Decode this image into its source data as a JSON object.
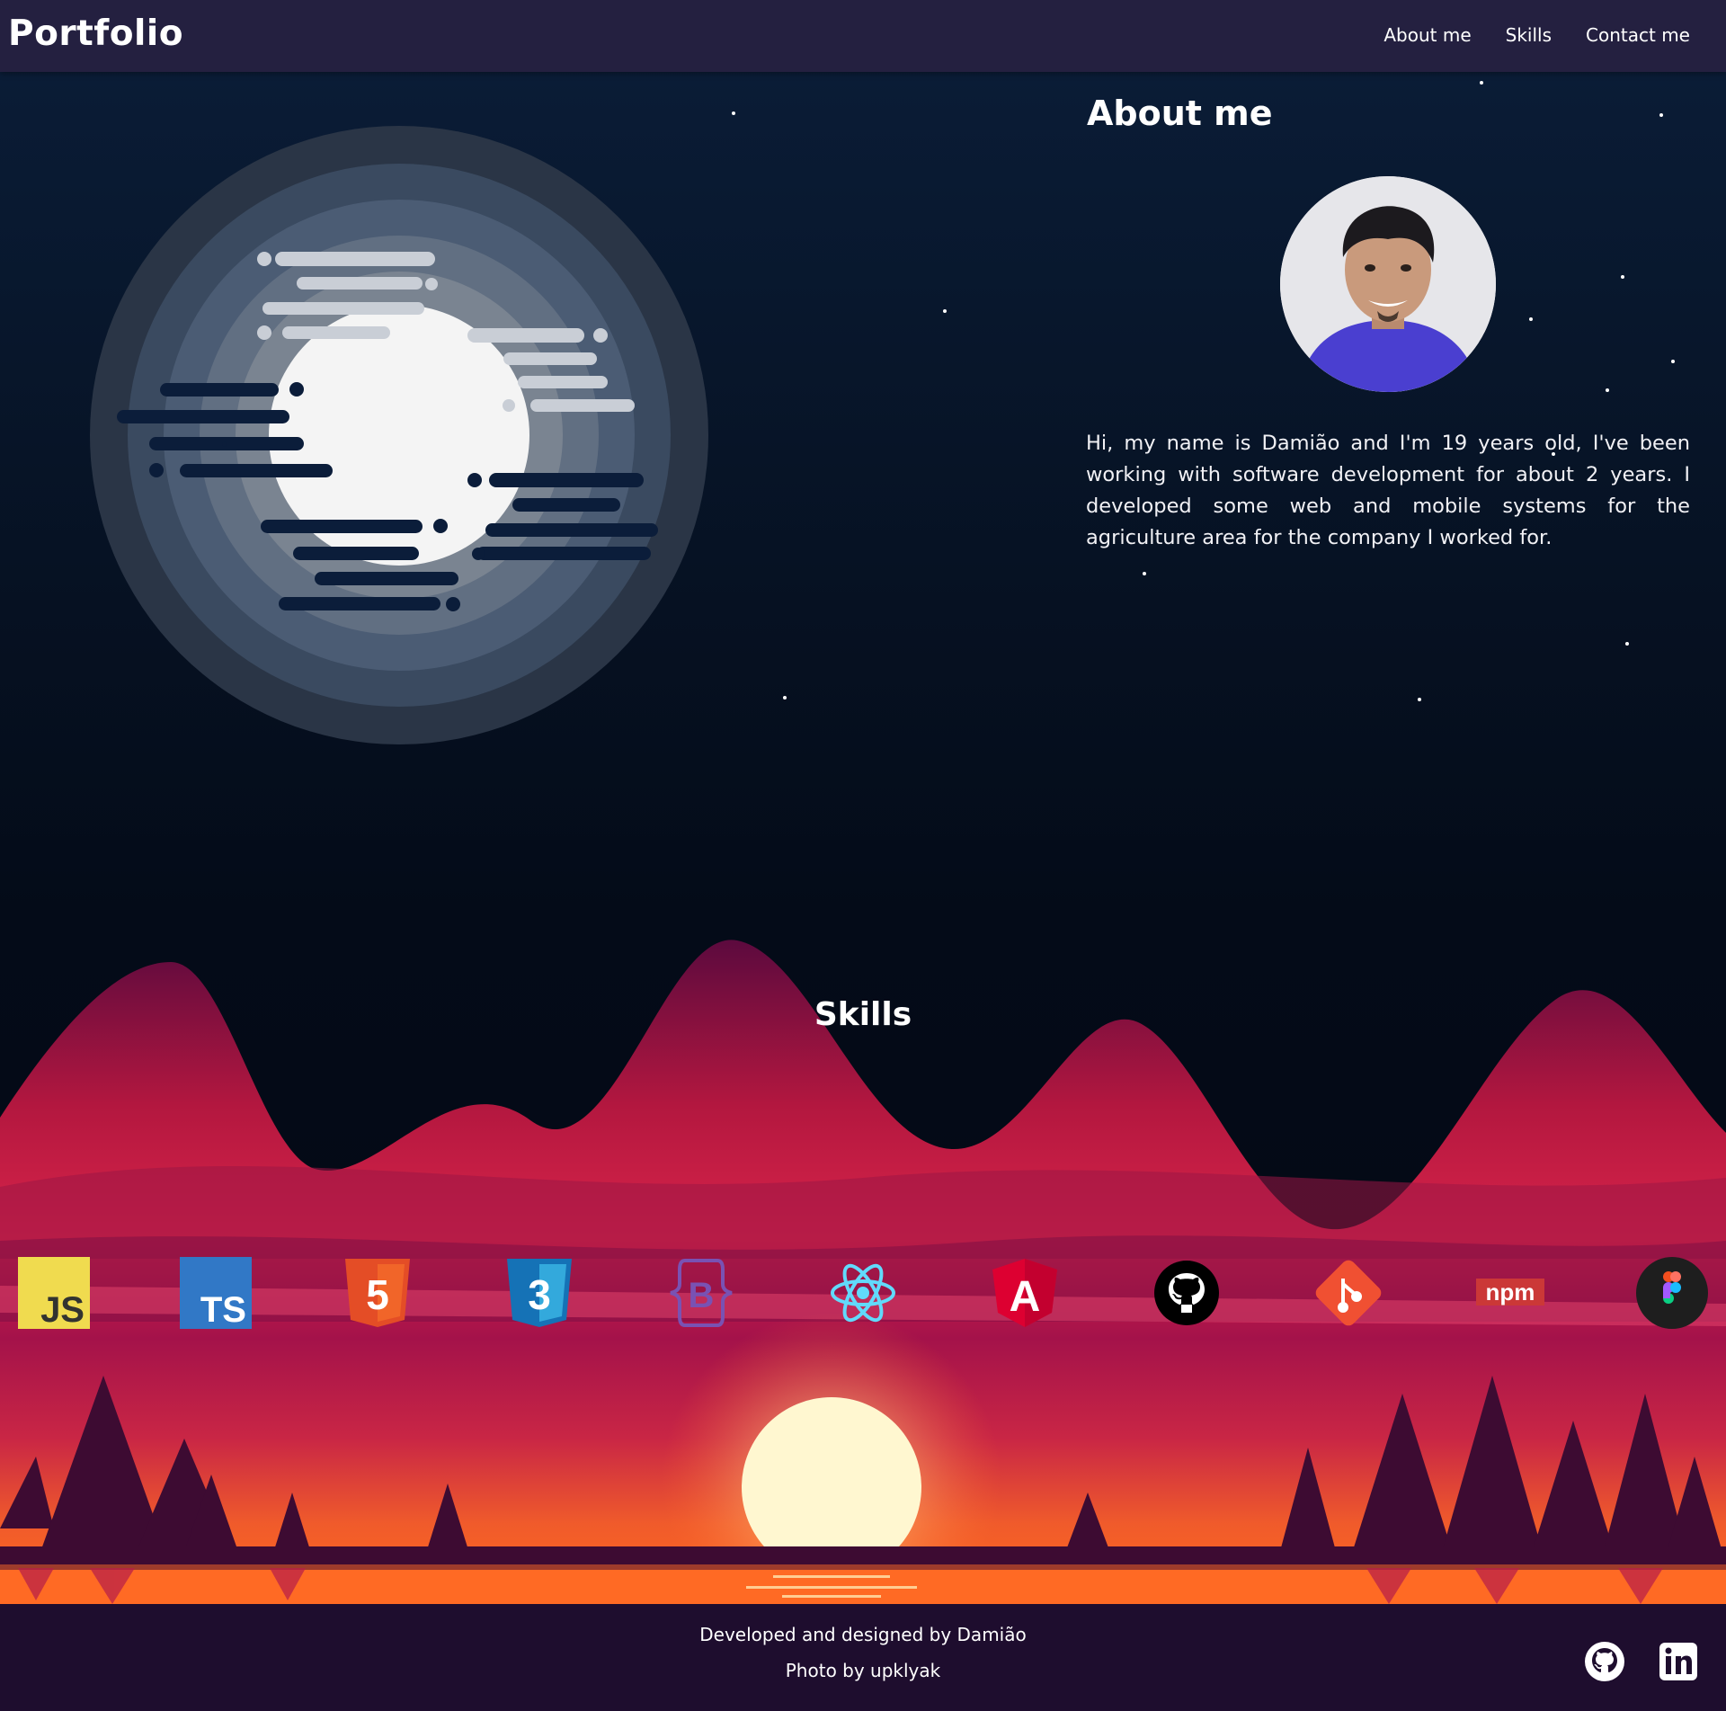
{
  "navbar": {
    "brand": "Portfolio",
    "links": [
      "About me",
      "Skills",
      "Contact me"
    ]
  },
  "about": {
    "title": "About me",
    "text": "Hi, my name is Damião and I'm 19 years old, I've been working with software development for about 2 years. I developed some web and mobile systems for the agriculture area for the company I worked for."
  },
  "skills": {
    "title": "Skills",
    "items": [
      {
        "name": "javascript-icon",
        "label": "JS",
        "color": "#f0db4f"
      },
      {
        "name": "typescript-icon",
        "label": "TS",
        "color": "#3178c6"
      },
      {
        "name": "html5-icon",
        "label": "5",
        "color": "#e44d26"
      },
      {
        "name": "css3-icon",
        "label": "3",
        "color": "#1572b6"
      },
      {
        "name": "bootstrap-icon",
        "label": "B",
        "color": "#7952b3"
      },
      {
        "name": "react-icon",
        "color": "#61dafb"
      },
      {
        "name": "angular-icon",
        "label": "A",
        "color": "#dd0031"
      },
      {
        "name": "github-icon",
        "color": "#000000"
      },
      {
        "name": "git-icon",
        "color": "#f05032"
      },
      {
        "name": "npm-icon",
        "label": "npm",
        "color": "#cb3837"
      },
      {
        "name": "figma-icon",
        "color": "#1e1e1e"
      }
    ]
  },
  "footer": {
    "credit": "Developed and designed by Damião",
    "photo_credit": "Photo by upklyak",
    "social": [
      "github-icon",
      "linkedin-icon"
    ]
  },
  "colors": {
    "navbar": "#242040",
    "sky": "#040b18",
    "footer": "#1e0d2e",
    "accent": "#ef2f56"
  }
}
